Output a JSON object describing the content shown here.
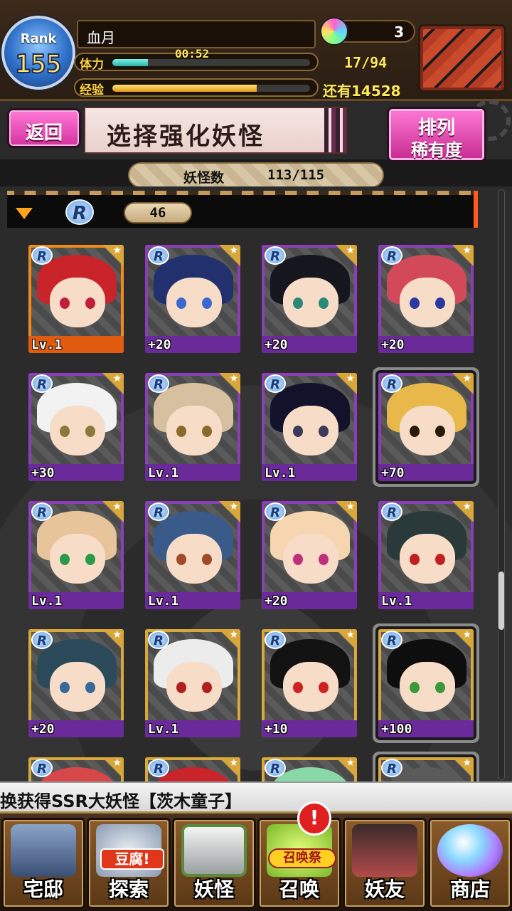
{
  "header": {
    "rank_word": "Rank",
    "rank_value": "155",
    "player_name": "血月",
    "stamina_label": "体力",
    "stamina_fill": 0.18,
    "stamina_timer": "00:52",
    "stamina_count": "17/94",
    "exp_label": "经验",
    "exp_fill": 0.73,
    "exp_remaining": "还有14528",
    "orb_count": "3"
  },
  "titlebar": {
    "back_label": "返回",
    "title": "选择强化妖怪",
    "sort_label_1": "排列",
    "sort_label_2": "稀有度"
  },
  "yokai_count": {
    "label": "妖怪数",
    "value": "113/115"
  },
  "group": {
    "rarity": "R",
    "count": "46"
  },
  "cards": [
    {
      "footer": "Lv.1",
      "frame": "#f08a1a",
      "foot_bg": "#e05a10",
      "hair": "#c8242a",
      "eye": "#c01e3a",
      "selected": false
    },
    {
      "footer": "+20",
      "frame": "#8a3fb8",
      "foot_bg": "#6a2a9a",
      "hair": "#22306e",
      "eye": "#3a6ad0",
      "selected": false
    },
    {
      "footer": "+20",
      "frame": "#8a3fb8",
      "foot_bg": "#6a2a9a",
      "hair": "#16161e",
      "eye": "#2a8a7a",
      "selected": false
    },
    {
      "footer": "+20",
      "frame": "#8a3fb8",
      "foot_bg": "#6a2a9a",
      "hair": "#d24a5a",
      "eye": "#2a3aa0",
      "selected": false
    },
    {
      "footer": "+30",
      "frame": "#8a3fb8",
      "foot_bg": "#6a2a9a",
      "hair": "#f2f2f2",
      "eye": "#8a7a3a",
      "selected": false
    },
    {
      "footer": "Lv.1",
      "frame": "#8a3fb8",
      "foot_bg": "#6a2a9a",
      "hair": "#d7c0a0",
      "eye": "#8a6a2a",
      "selected": false
    },
    {
      "footer": "Lv.1",
      "frame": "#8a3fb8",
      "foot_bg": "#6a2a9a",
      "hair": "#12122a",
      "eye": "#3a3a5a",
      "selected": false
    },
    {
      "footer": "+70",
      "frame": "#8a3fb8",
      "foot_bg": "#6a2a9a",
      "hair": "#e8b84a",
      "eye": "#2a1a0a",
      "selected": true
    },
    {
      "footer": "Lv.1",
      "frame": "#8a3fb8",
      "foot_bg": "#6a2a9a",
      "hair": "#e8c49a",
      "eye": "#2a9a4a",
      "selected": false
    },
    {
      "footer": "Lv.1",
      "frame": "#8a3fb8",
      "foot_bg": "#6a2a9a",
      "hair": "#3a5a8a",
      "eye": "#a04a2a",
      "selected": false
    },
    {
      "footer": "+20",
      "frame": "#8a3fb8",
      "foot_bg": "#6a2a9a",
      "hair": "#f5d6b0",
      "eye": "#c0307a",
      "selected": false
    },
    {
      "footer": "Lv.1",
      "frame": "#8a3fb8",
      "foot_bg": "#6a2a9a",
      "hair": "#2a3a3a",
      "eye": "#c02020",
      "selected": false
    },
    {
      "footer": "+20",
      "frame": "#d8a83a",
      "foot_bg": "#6a2a9a",
      "hair": "#2a4a5a",
      "eye": "#3a6a9a",
      "selected": false
    },
    {
      "footer": "Lv.1",
      "frame": "#d8a83a",
      "foot_bg": "#6a2a9a",
      "hair": "#ececec",
      "eye": "#b02020",
      "selected": false
    },
    {
      "footer": "+10",
      "frame": "#d8a83a",
      "foot_bg": "#6a2a9a",
      "hair": "#121212",
      "eye": "#d02020",
      "selected": false
    },
    {
      "footer": "+100",
      "frame": "#d8a83a",
      "foot_bg": "#6a2a9a",
      "hair": "#0e0e0e",
      "eye": "#3a9a3a",
      "selected": true
    },
    {
      "footer": "",
      "frame": "#d8a83a",
      "foot_bg": "#6a2a9a",
      "hair": "#d6484a",
      "eye": "#000000",
      "selected": false
    },
    {
      "footer": "",
      "frame": "#d8a83a",
      "foot_bg": "#6a2a9a",
      "hair": "#c8242a",
      "eye": "#000000",
      "selected": false
    },
    {
      "footer": "",
      "frame": "#d8a83a",
      "foot_bg": "#6a2a9a",
      "hair": "#8ad8a8",
      "eye": "#000000",
      "selected": false
    },
    {
      "footer": "",
      "frame": "#d8a83a",
      "foot_bg": "#6a2a9a",
      "hair": "#5a5a5a",
      "eye": "#000000",
      "selected": true
    }
  ],
  "ticker": {
    "text": "换获得SSR大妖怪【茨木童子】"
  },
  "nav": {
    "home": "宅邸",
    "explore": "探索",
    "explore_sticker": "豆腐!",
    "yokai": "妖怪",
    "summon": "召唤",
    "summon_sticker": "召唤祭",
    "friends": "妖友",
    "shop": "商店",
    "alert": "!"
  },
  "icons": [
    "rank-star-icon",
    "orb-icon",
    "treasure-chest-icon",
    "gear-icon",
    "rarity-r-icon",
    "star-icon",
    "dropdown-triangle-icon",
    "alert-icon"
  ]
}
